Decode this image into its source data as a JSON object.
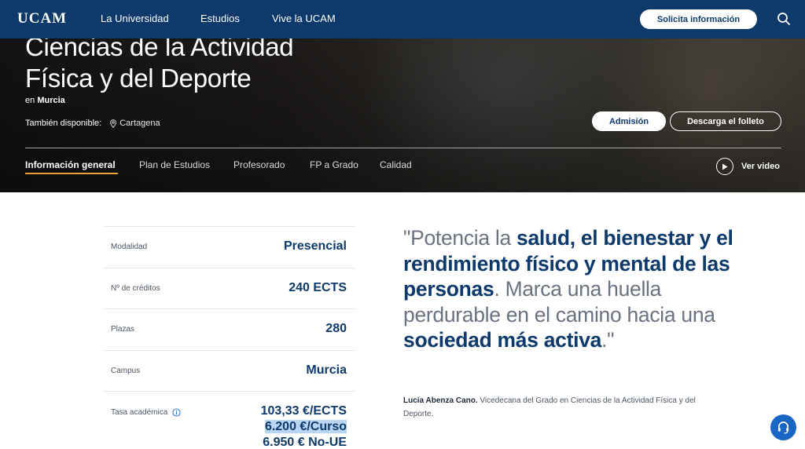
{
  "nav": {
    "logo": "UCAM",
    "links": [
      "La Universidad",
      "Estudios",
      "Vive la UCAM"
    ],
    "cta": "Solicita información"
  },
  "hero": {
    "title_line1": "Ciencias de la Actividad",
    "title_line2": "Física y del Deporte",
    "location_prefix": "en",
    "location": "Murcia",
    "also_label": "También disponible:",
    "also_campus": "Cartagena",
    "btn_admision": "Admisión",
    "btn_folleto": "Descarga el folleto",
    "tabs": [
      "Información general",
      "Plan de Estudios",
      "Profesorado",
      "FP a Grado",
      "Calidad"
    ],
    "video_label": "Ver video"
  },
  "info": {
    "rows": [
      {
        "label": "Modalidad",
        "value": "Presencial"
      },
      {
        "label": "Nº de créditos",
        "value": "240 ECTS"
      },
      {
        "label": "Plazas",
        "value": "280"
      },
      {
        "label": "Campus",
        "value": "Murcia"
      }
    ],
    "tasa_label": "Tasa académica",
    "tasa_values": [
      "103,33 €/ECTS",
      "6.200 €/Curso",
      "6.950 € No-UE"
    ]
  },
  "quote": {
    "p1": "\"Potencia la ",
    "b1": "salud, el bienestar y el rendimiento físico y mental de las personas",
    "p2": ". Marca una huella perdurable en el camino hacia una ",
    "b2": "sociedad más activa",
    "p3": ".\"",
    "author_name": "Lucía Abenza Cano.",
    "author_role": " Vicedecana del Grado en Ciencias de la Actividad Física y del Deporte."
  },
  "colors": {
    "primary": "#0d3a6b",
    "accent": "#e3a33a",
    "chat": "#1a66c4"
  },
  "icons": [
    "search-icon",
    "map-pin-icon",
    "play-icon",
    "info-icon",
    "headset-icon"
  ]
}
